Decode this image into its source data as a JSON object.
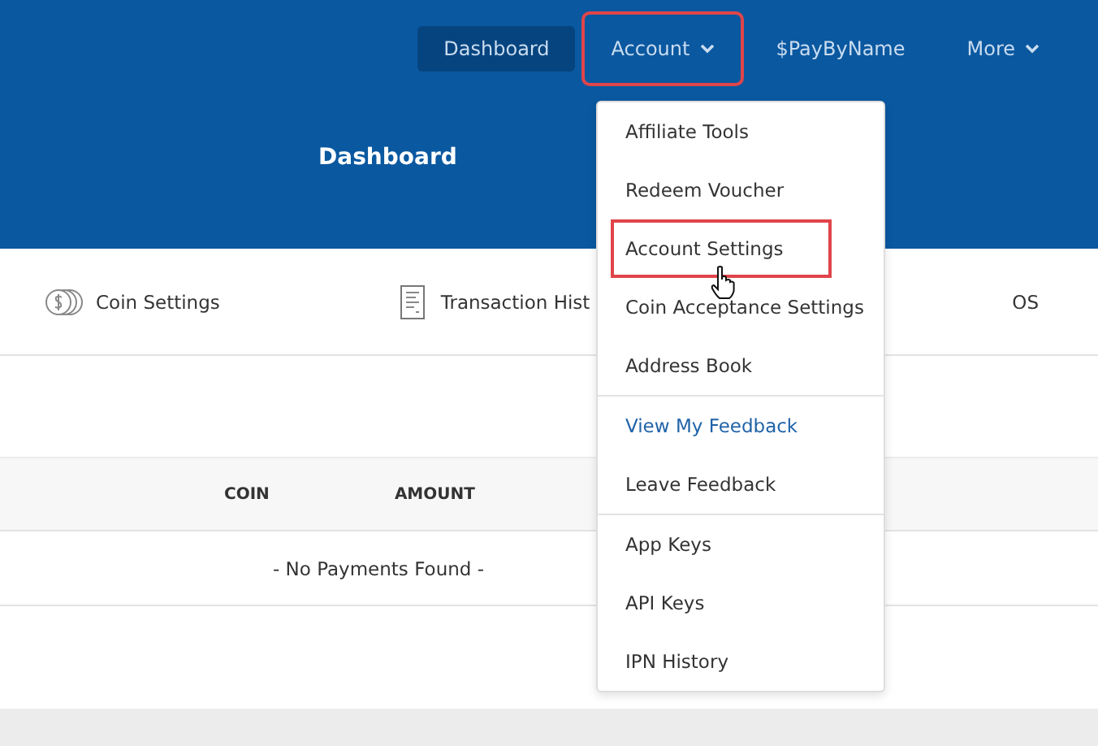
{
  "nav": [
    {
      "label": "Dashboard",
      "selected": true,
      "caret": false,
      "highlighted": false
    },
    {
      "label": "Account",
      "selected": false,
      "caret": true,
      "highlighted": true
    },
    {
      "label": "$PayByName",
      "selected": false,
      "caret": false,
      "highlighted": false
    },
    {
      "label": "More",
      "selected": false,
      "caret": true,
      "highlighted": false
    }
  ],
  "page_title": "Dashboard",
  "tabs": [
    {
      "label": "Coin Settings"
    },
    {
      "label": "Transaction Hist"
    },
    {
      "label": "OS"
    }
  ],
  "table": {
    "columns": [
      "COIN",
      "AMOUNT"
    ],
    "empty_message": "- No Payments Found -"
  },
  "menu": {
    "groups": [
      [
        {
          "label": "Affiliate Tools",
          "kind": "item",
          "highlighted": false
        },
        {
          "label": "Redeem Voucher",
          "kind": "item",
          "highlighted": false
        },
        {
          "label": "Account Settings",
          "kind": "item",
          "highlighted": true
        },
        {
          "label": "Coin Acceptance Settings",
          "kind": "item",
          "highlighted": false
        },
        {
          "label": "Address Book",
          "kind": "item",
          "highlighted": false
        }
      ],
      [
        {
          "label": "View My Feedback",
          "kind": "link",
          "highlighted": false
        },
        {
          "label": "Leave Feedback",
          "kind": "item",
          "highlighted": false
        }
      ],
      [
        {
          "label": "App Keys",
          "kind": "item",
          "highlighted": false
        },
        {
          "label": "API Keys",
          "kind": "item",
          "highlighted": false
        },
        {
          "label": "IPN History",
          "kind": "item",
          "highlighted": false
        }
      ]
    ]
  }
}
